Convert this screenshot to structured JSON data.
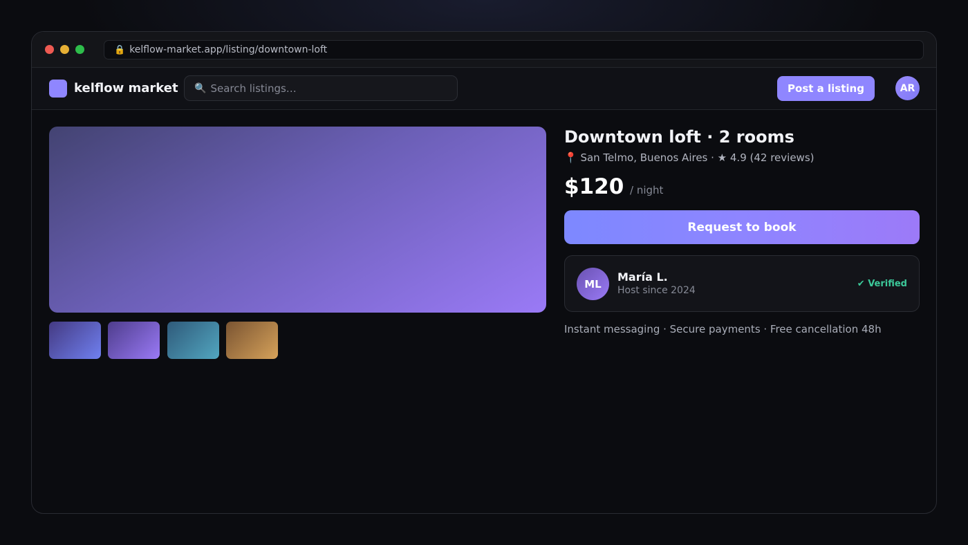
{
  "browser": {
    "url": "kelflow-market.app/listing/downtown-loft"
  },
  "navbar": {
    "brand": "kelflow market",
    "search_placeholder": "Search listings…",
    "post_label": "Post a listing",
    "avatar_initials": "AR"
  },
  "listing": {
    "title": "Downtown loft · 2 rooms",
    "meta": "📍 San Telmo, Buenos Aires · ★ 4.9 (42 reviews)",
    "price": "$120",
    "price_unit": "/ night",
    "book_label": "Request to book",
    "features": "Instant messaging · Secure payments · Free cancellation 48h"
  },
  "host": {
    "initials": "ML",
    "name": "María L.",
    "since": "Host since 2024",
    "badge": "✔ Verified"
  },
  "colors": {
    "accent": "#8f86ff",
    "verified": "#3cc99a",
    "background": "#0b0c10"
  }
}
